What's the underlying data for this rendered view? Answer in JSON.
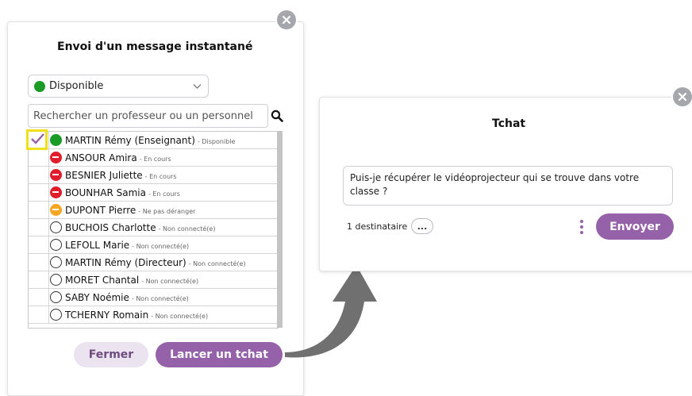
{
  "left_dialog": {
    "title": "Envoi d'un message instantané",
    "status_selected": "Disponible",
    "search_placeholder": "Rechercher un professeur ou un personnel",
    "contacts": [
      {
        "name": "MARTIN Rémy (Enseignant)",
        "status": "- Disponible",
        "state": "available",
        "checked": true
      },
      {
        "name": "ANSOUR Amira",
        "status": "- En cours",
        "state": "busy",
        "checked": false
      },
      {
        "name": "BESNIER Juliette",
        "status": "- En cours",
        "state": "busy",
        "checked": false
      },
      {
        "name": "BOUNHAR Samia",
        "status": "- En cours",
        "state": "busy",
        "checked": false
      },
      {
        "name": "DUPONT Pierre",
        "status": "- Ne pas déranger",
        "state": "dnd",
        "checked": false
      },
      {
        "name": "BUCHOIS Charlotte",
        "status": "- Non connecté(e)",
        "state": "offline",
        "checked": false
      },
      {
        "name": "LEFOLL Marie",
        "status": "- Non connecté(e)",
        "state": "offline",
        "checked": false
      },
      {
        "name": "MARTIN Rémy (Directeur)",
        "status": "- Non connecté(e)",
        "state": "offline",
        "checked": false
      },
      {
        "name": "MORET Chantal",
        "status": "- Non connecté(e)",
        "state": "offline",
        "checked": false
      },
      {
        "name": "SABY Noémie",
        "status": "- Non connecté(e)",
        "state": "offline",
        "checked": false
      },
      {
        "name": "TCHERNY Romain",
        "status": "- Non connecté(e)",
        "state": "offline",
        "checked": false
      }
    ],
    "close_label": "Fermer",
    "launch_label": "Lancer un tchat"
  },
  "right_dialog": {
    "title": "Tchat",
    "message": "Puis-je récupérer le vidéoprojecteur qui se trouve dans votre classe ?",
    "recipients": "1 destinataire",
    "more_label": "...",
    "send_label": "Envoyer"
  },
  "colors": {
    "accent": "#9561a8",
    "available": "#1a9b25",
    "busy": "#e21d2b",
    "dnd": "#f5a623",
    "highlight": "#f0e01b"
  },
  "icons": {
    "close": "close-icon",
    "search": "search-icon",
    "dropdown": "chevron-down-icon",
    "check": "checkmark-icon",
    "menu": "kebab-menu-icon",
    "arrow": "curved-arrow-icon"
  }
}
